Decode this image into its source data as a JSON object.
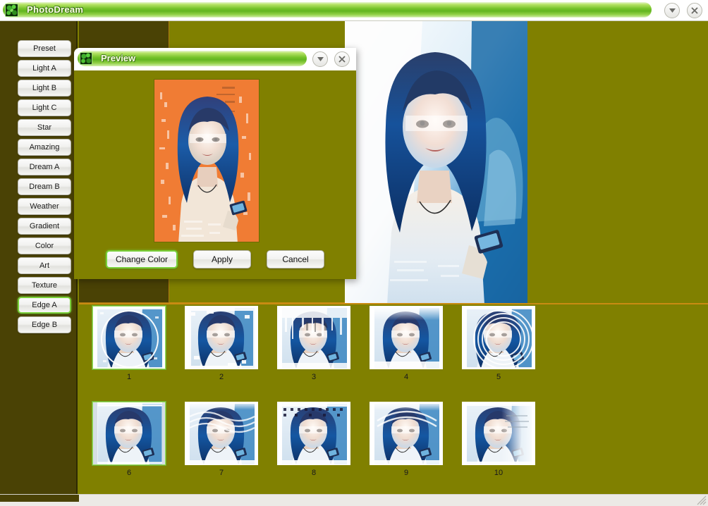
{
  "window": {
    "title": "PhotoDream",
    "icon": "app-leaf-icon",
    "buttons": [
      {
        "name": "menu-dropdown-button",
        "icon": "chevron-down-icon"
      },
      {
        "name": "close-button",
        "icon": "close-x-icon"
      }
    ]
  },
  "sidebar": {
    "items": [
      {
        "label": "Preset",
        "selected": false
      },
      {
        "label": "Light A",
        "selected": false
      },
      {
        "label": "Light B",
        "selected": false
      },
      {
        "label": "Light C",
        "selected": false
      },
      {
        "label": "Star",
        "selected": false
      },
      {
        "label": "Amazing",
        "selected": false
      },
      {
        "label": "Dream A",
        "selected": false
      },
      {
        "label": "Dream B",
        "selected": false
      },
      {
        "label": "Weather",
        "selected": false
      },
      {
        "label": "Gradient",
        "selected": false
      },
      {
        "label": "Color",
        "selected": false
      },
      {
        "label": "Art",
        "selected": false
      },
      {
        "label": "Texture",
        "selected": false
      },
      {
        "label": "Edge A",
        "selected": true
      },
      {
        "label": "Edge B",
        "selected": false
      }
    ]
  },
  "dialog": {
    "title": "Preview",
    "icon": "app-leaf-icon",
    "buttons": [
      {
        "name": "dialog-menu-dropdown-button",
        "icon": "chevron-down-icon"
      },
      {
        "name": "dialog-close-button",
        "icon": "close-x-icon"
      }
    ],
    "preview_image_alt": "edge-effect-preview-orange",
    "actions": [
      {
        "label": "Change Color",
        "name": "change-color-button",
        "focused": true
      },
      {
        "label": "Apply",
        "name": "apply-button",
        "focused": false
      },
      {
        "label": "Cancel",
        "name": "cancel-button",
        "focused": false
      }
    ]
  },
  "main": {
    "image_alt": "main-photo-blue-portrait"
  },
  "thumbnails": {
    "rows": [
      [
        {
          "label": "1",
          "effect": "circle-ring-edge",
          "selected": true
        },
        {
          "label": "2",
          "effect": "soft-scatter-edge",
          "selected": false
        },
        {
          "label": "3",
          "effect": "vertical-streak",
          "selected": false
        },
        {
          "label": "4",
          "effect": "faded-top",
          "selected": false
        },
        {
          "label": "5",
          "effect": "concentric-arcs",
          "selected": false
        }
      ],
      [
        {
          "label": "6",
          "effect": "square-frame",
          "selected": true
        },
        {
          "label": "7",
          "effect": "ripple-fade",
          "selected": false
        },
        {
          "label": "8",
          "effect": "dotted-border",
          "selected": false
        },
        {
          "label": "9",
          "effect": "arc-sweep",
          "selected": false
        },
        {
          "label": "10",
          "effect": "motion-blur-right",
          "selected": false
        }
      ]
    ]
  },
  "colors": {
    "workspace_olive": "#808000",
    "panel_dark_olive": "#4a4205",
    "accent_green": "#76c32a",
    "separator_orange": "#c98b12",
    "selection_green": "#79d03a",
    "preview_orange": "#f07c34",
    "statusbar_gray": "#eceae6"
  }
}
